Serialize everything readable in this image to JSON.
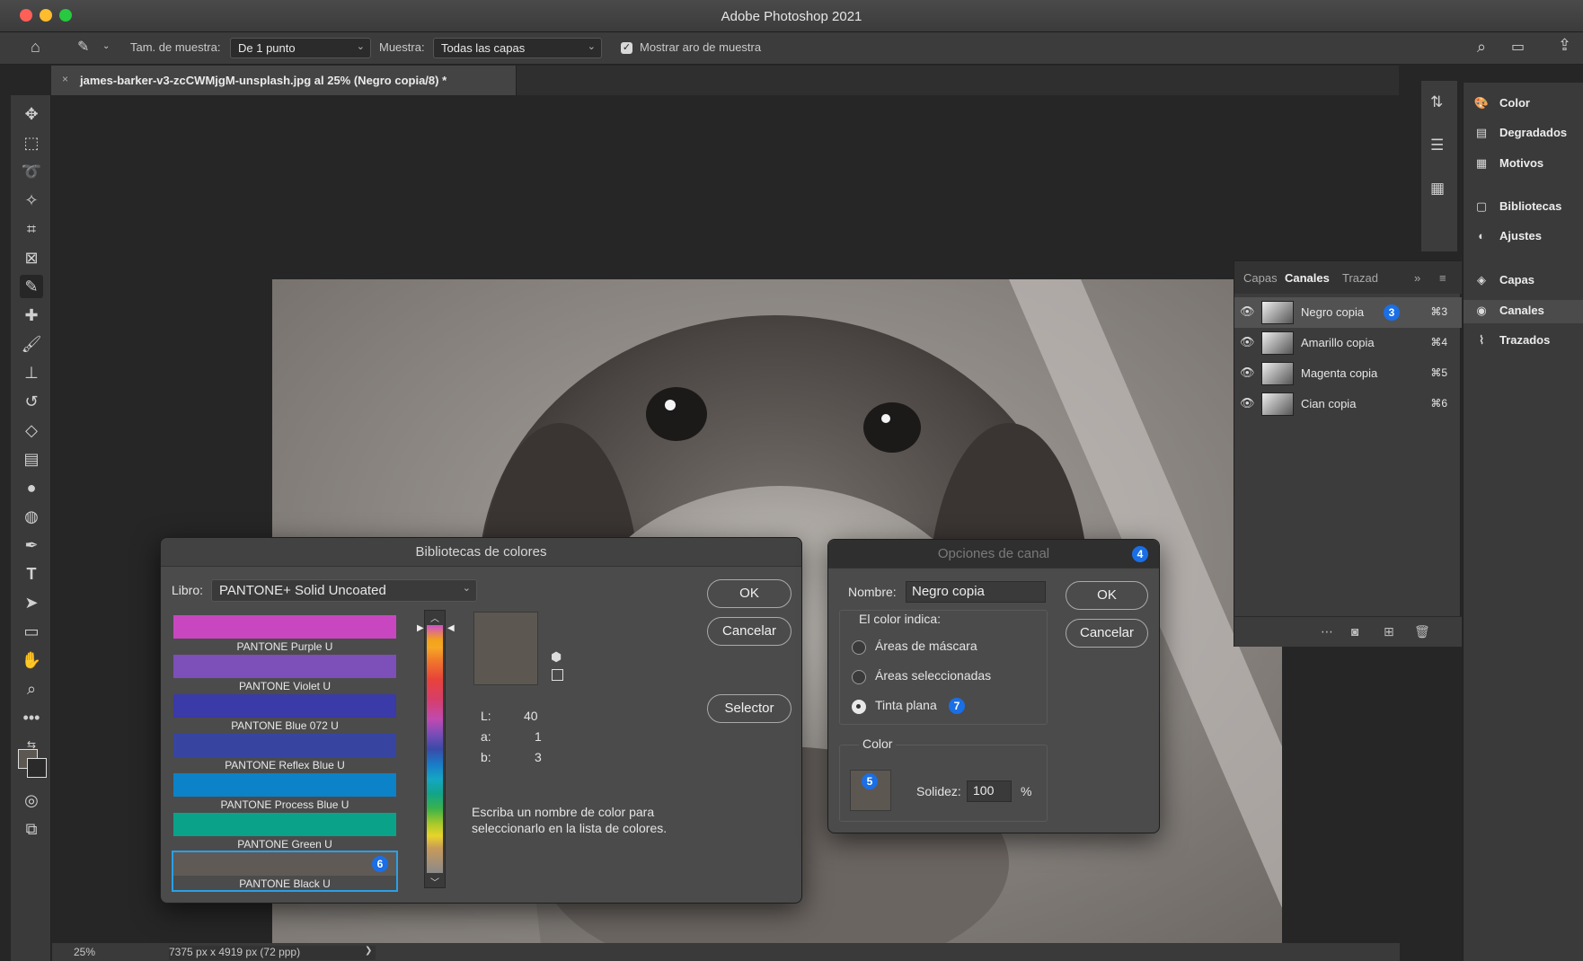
{
  "window": {
    "title": "Adobe Photoshop 2021"
  },
  "options_bar": {
    "sample_size_label": "Tam. de muestra:",
    "sample_size_value": "De 1 punto",
    "sample_label": "Muestra:",
    "sample_value": "Todas las capas",
    "show_ring_label": "Mostrar aro de muestra",
    "show_ring_checked": "✓"
  },
  "document_tab": {
    "close": "×",
    "name": "james-barker-v3-zcCWMjgM-unsplash.jpg al 25% (Negro copia/8) *"
  },
  "status_bar": {
    "zoom": "25%",
    "dimensions": "7375 px x 4919 px (72 ppp)",
    "arrow": "❯"
  },
  "dock": {
    "items": [
      {
        "label": "Color"
      },
      {
        "label": "Degradados"
      },
      {
        "label": "Motivos"
      },
      {
        "label": "Bibliotecas"
      },
      {
        "label": "Ajustes"
      },
      {
        "label": "Capas"
      },
      {
        "label": "Canales"
      },
      {
        "label": "Trazados"
      }
    ]
  },
  "channels_panel": {
    "tabs": [
      "Capas",
      "Canales",
      "Trazad"
    ],
    "rows": [
      {
        "label": "Negro copia",
        "shortcut": "⌘3",
        "badge": "3"
      },
      {
        "label": "Amarillo copia",
        "shortcut": "⌘4"
      },
      {
        "label": "Magenta copia",
        "shortcut": "⌘5"
      },
      {
        "label": "Cian copia",
        "shortcut": "⌘6"
      }
    ]
  },
  "color_libraries": {
    "title": "Bibliotecas de colores",
    "book_label": "Libro:",
    "book_value": "PANTONE+ Solid Uncoated",
    "swatches": [
      {
        "name": "PANTONE Purple U",
        "color": "#c847c0"
      },
      {
        "name": "PANTONE Violet U",
        "color": "#7d4fb8"
      },
      {
        "name": "PANTONE Blue 072 U",
        "color": "#3a3aa8"
      },
      {
        "name": "PANTONE Reflex Blue U",
        "color": "#3845a0"
      },
      {
        "name": "PANTONE Process Blue U",
        "color": "#0c82c8"
      },
      {
        "name": "PANTONE Green U",
        "color": "#0aa38a"
      },
      {
        "name": "PANTONE Black U",
        "color": "#5f5a56",
        "badge": "6"
      }
    ],
    "lab": {
      "L_label": "L:",
      "L": "40",
      "a_label": "a:",
      "a": "1",
      "b_label": "b:",
      "b": "3"
    },
    "hint": "Escriba un nombre de color para seleccionarlo en la lista de colores.",
    "ok": "OK",
    "cancel": "Cancelar",
    "picker": "Selector",
    "preview_color": "#5d5752"
  },
  "channel_options": {
    "title": "Opciones de canal",
    "title_badge": "4",
    "name_label": "Nombre:",
    "name_value": "Negro copia",
    "color_indicates_label": "El color indica:",
    "options": [
      "Áreas de máscara",
      "Áreas seleccionadas",
      "Tinta plana"
    ],
    "spot_badge": "7",
    "color_group_label": "Color",
    "color_badge": "5",
    "solidity_label": "Solidez:",
    "solidity_value": "100",
    "percent": "%",
    "ok": "OK",
    "cancel": "Cancelar",
    "swatch_color": "#5d5752"
  }
}
